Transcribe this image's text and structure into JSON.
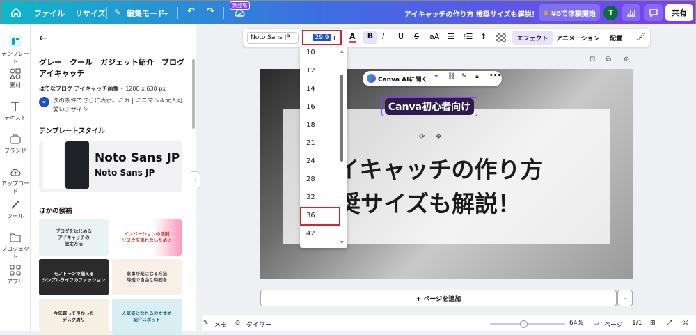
{
  "topbar": {
    "file": "ファイル",
    "resize": "リサイズ",
    "edit_mode": "編集モード",
    "new_badge": "新登場",
    "doc_title": "アイキャッチの作り方 推奨サイズも解説！",
    "trial": "¥0で体験開始",
    "avatar": "T",
    "share": "共有"
  },
  "rail": {
    "items": [
      "テンプレート",
      "素材",
      "テキスト",
      "ブランド",
      "アップロード",
      "ツール",
      "プロジェクト",
      "アプリ"
    ]
  },
  "panel": {
    "title": "グレー　クール　ガジェット紹介　ブログアイキャッチ",
    "meta_bold": "はてなブログ アイキャッチ画像",
    "meta_size": " • 1200 x 630 px",
    "author_avatar": "ミ",
    "author_text": "次の条件でさらに表示。ミカ | ミニマル＆大人可愛いデザイン",
    "style_title": "テンプレートスタイル",
    "font_primary": "Noto Sans JP",
    "font_secondary": "Noto Sans JP",
    "more_title": "ほかの候補",
    "thumbs": [
      "ブログをはじめる\nアイキャッチの\n設定方法",
      "イノベーションの法則\nリスクを恐れないために",
      "モノトーンで揃える\nシンプルライフのファッション",
      "家事が楽になる方法\n時短で自由な時間を",
      "今年買って良かった\nデスク周り",
      "人気者になれるおすすめ\n紹介スポット"
    ]
  },
  "toolbar": {
    "font": "Noto Sans JP",
    "minus": "−",
    "size": "29.9",
    "plus": "+",
    "color_letter": "A",
    "bold": "B",
    "italic": "I",
    "underline": "U",
    "strike": "S",
    "case": "aA",
    "effect": "エフェクト",
    "animation": "アニメーション",
    "position": "配置"
  },
  "font_sizes": [
    "10",
    "12",
    "14",
    "16",
    "18",
    "21",
    "24",
    "28",
    "32",
    "36",
    "42"
  ],
  "highlighted_size": "36",
  "canvas": {
    "chip": "Canva初心者向け",
    "ai_label": "Canva AIに聞く",
    "line1": "アイキャッチの作り方",
    "line2": "推奨サイズも解説！"
  },
  "add_page": "+ ページを追加",
  "status": {
    "memo": "メモ",
    "timer": "タイマー",
    "zoom": "64%",
    "page_label": "ページ",
    "page_count": "1/1"
  }
}
